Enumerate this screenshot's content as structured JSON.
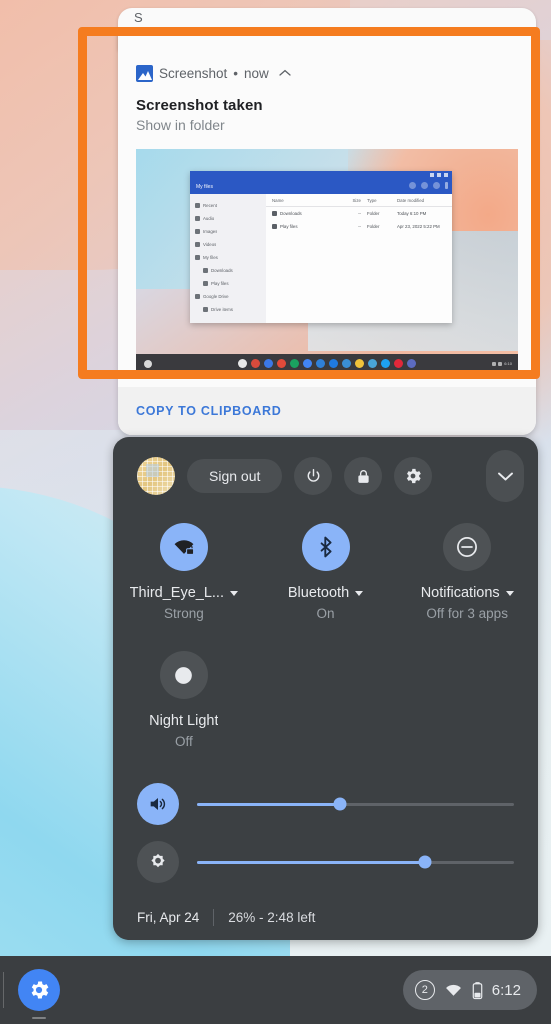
{
  "notification_above": {
    "sliver_text": "S",
    "sliver_right": ""
  },
  "notification": {
    "app_icon": "image-icon",
    "app_name": "Screenshot",
    "separator": "•",
    "time": "now",
    "collapse_icon": "chevron-up-icon",
    "title": "Screenshot taken",
    "subtitle": "Show in folder",
    "action_label": "COPY TO CLIPBOARD",
    "thumbnail": {
      "window_title": "My files",
      "titlebar_icons": [
        "search-icon",
        "view-toggle-icon",
        "more-vert-icon",
        "menu-icon"
      ],
      "sidebar": [
        {
          "label": "Recent",
          "icon": "clock-icon",
          "indent": false
        },
        {
          "label": "Audio",
          "icon": "audio-icon",
          "indent": false
        },
        {
          "label": "Images",
          "icon": "image-icon",
          "indent": false
        },
        {
          "label": "Videos",
          "icon": "video-icon",
          "indent": false
        },
        {
          "label": "My files",
          "icon": "folder-icon",
          "indent": false
        },
        {
          "label": "Downloads",
          "icon": "download-icon",
          "indent": true
        },
        {
          "label": "Play files",
          "icon": "play-icon",
          "indent": true
        },
        {
          "label": "Google Drive",
          "icon": "drive-icon",
          "indent": false
        },
        {
          "label": "Drive items",
          "icon": "drive-icon",
          "indent": true
        }
      ],
      "columns": [
        "Name",
        "Size",
        "Type",
        "Date modified"
      ],
      "rows": [
        {
          "name": "Downloads",
          "size": "--",
          "type": "Folder",
          "date": "Today 6:10 PM"
        },
        {
          "name": "Play files",
          "size": "--",
          "type": "Folder",
          "date": "Apr 23, 2022 5:22 PM"
        }
      ],
      "shelf_app_colors": [
        "#e8e8e8",
        "#d94b3c",
        "#3b78e7",
        "#e04a3a",
        "#1aa260",
        "#4285f4",
        "#2f80d8",
        "#1f7ae0",
        "#3a8fd6",
        "#f0c23a",
        "#49a5d8",
        "#1da1f2",
        "#e1283a",
        "#5c6bc0"
      ],
      "shelf_clock": "6:10"
    }
  },
  "highlight": {
    "color": "#f57c1f"
  },
  "quick_settings": {
    "avatar": "user-avatar",
    "sign_out_label": "Sign out",
    "power_icon": "power-icon",
    "lock_icon": "lock-icon",
    "settings_icon": "gear-icon",
    "collapse_icon": "chevron-down-icon",
    "tiles": [
      {
        "name": "wifi",
        "icon": "wifi-locked-icon",
        "label": "Third_Eye_L...",
        "status": "Strong",
        "state": "on",
        "has_caret": true
      },
      {
        "name": "bluetooth",
        "icon": "bluetooth-icon",
        "label": "Bluetooth",
        "status": "On",
        "state": "on",
        "has_caret": true
      },
      {
        "name": "notifications",
        "icon": "do-not-disturb-icon",
        "label": "Notifications",
        "status": "Off for 3 apps",
        "state": "off",
        "has_caret": true
      },
      {
        "name": "night-light",
        "icon": "moon-icon",
        "label": "Night Light",
        "status": "Off",
        "state": "off",
        "has_caret": false
      }
    ],
    "sliders": [
      {
        "name": "volume",
        "icon": "volume-icon",
        "value": 45,
        "state": "on"
      },
      {
        "name": "brightness",
        "icon": "brightness-icon",
        "value": 72,
        "state": "off"
      }
    ],
    "date": "Fri, Apr 24",
    "battery": "26% - 2:48 left"
  },
  "shelf": {
    "launcher_icon": "settings-gear-icon",
    "status": {
      "badge_count": "2",
      "wifi_icon": "wifi-icon",
      "battery_icon": "battery-icon",
      "clock": "6:12"
    }
  }
}
